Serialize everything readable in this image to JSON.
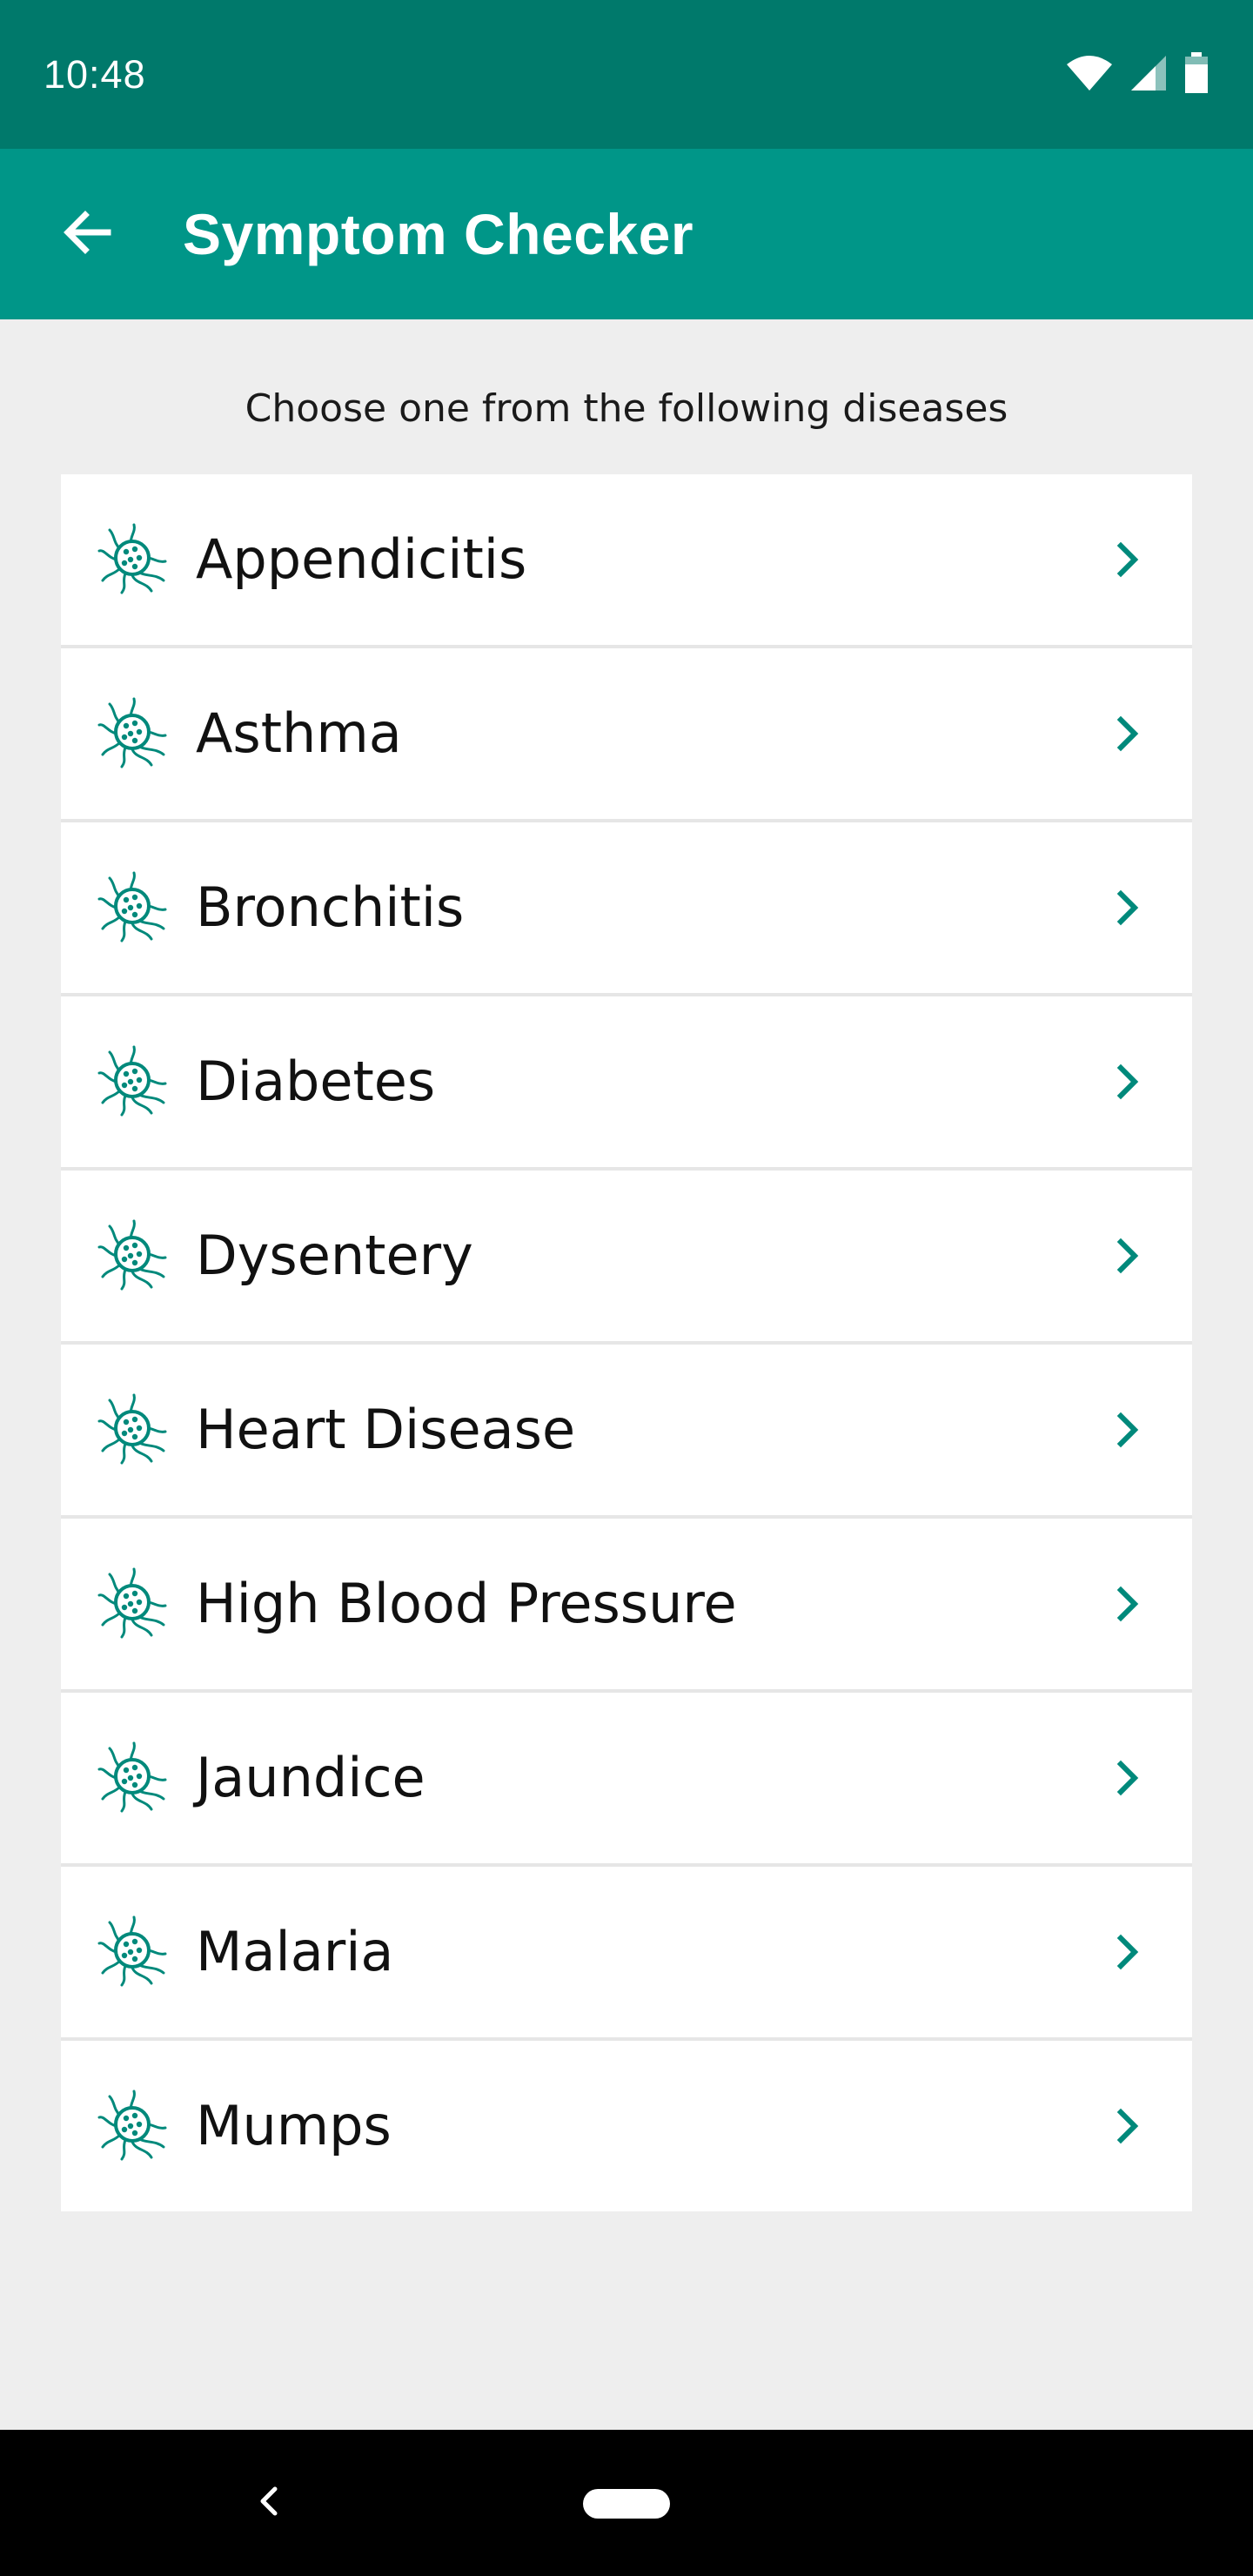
{
  "status_bar": {
    "time": "10:48",
    "icons": [
      "wifi-icon",
      "cellular-signal-icon",
      "battery-icon"
    ]
  },
  "app_bar": {
    "back_icon": "arrow-left-icon",
    "title": "Symptom Checker",
    "background": "#009688",
    "status_background": "#00796b"
  },
  "prompt": "Choose one from the following diseases",
  "diseases": [
    {
      "label": "Appendicitis"
    },
    {
      "label": "Asthma"
    },
    {
      "label": "Bronchitis"
    },
    {
      "label": "Diabetes"
    },
    {
      "label": "Dysentery"
    },
    {
      "label": "Heart Disease"
    },
    {
      "label": "High Blood Pressure"
    },
    {
      "label": "Jaundice"
    },
    {
      "label": "Malaria"
    },
    {
      "label": "Mumps"
    }
  ],
  "list_item_icon": "virus-icon",
  "list_item_trailing_icon": "chevron-right-icon",
  "accent_color": "#00897b",
  "nav_bar": {
    "icons": [
      "nav-back-icon",
      "home-pill-icon"
    ]
  }
}
